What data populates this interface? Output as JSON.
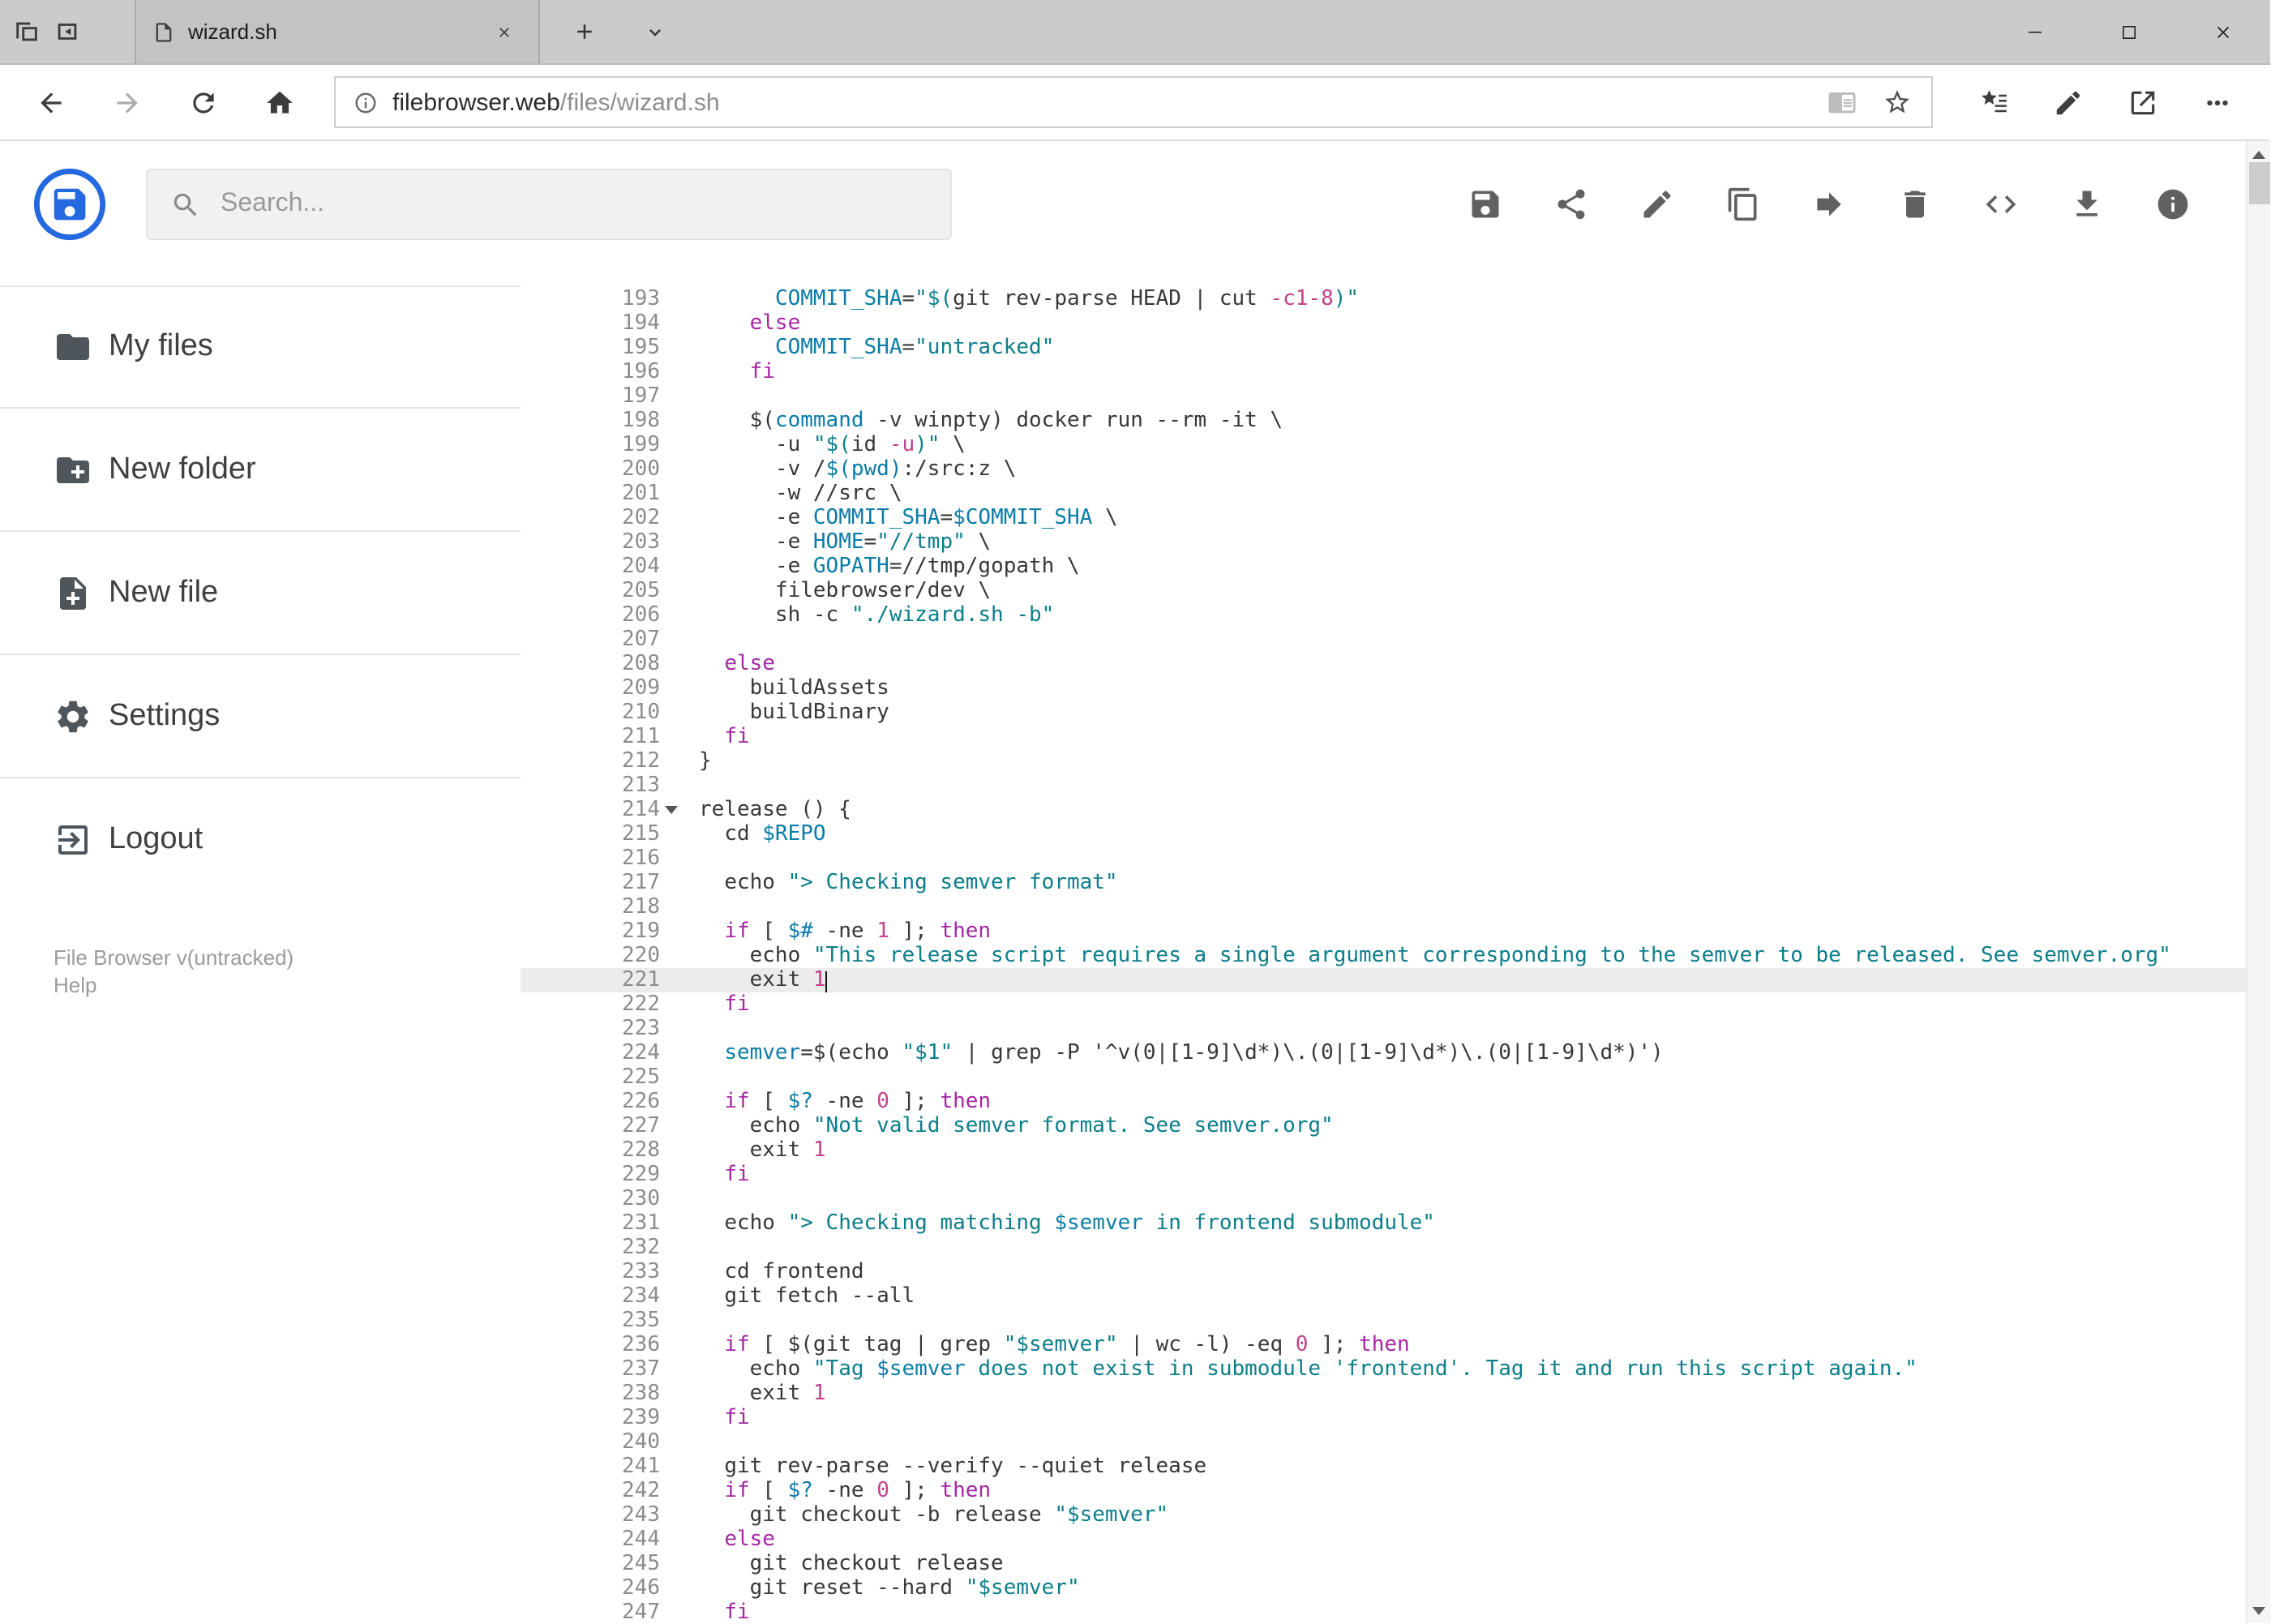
{
  "browser": {
    "tab": {
      "title": "wizard.sh"
    },
    "address": {
      "host": "filebrowser.web",
      "path": "/files/wizard.sh"
    }
  },
  "app": {
    "search_placeholder": "Search...",
    "toolbar_icons": [
      "save",
      "share",
      "rename",
      "copy",
      "move",
      "delete",
      "code",
      "download",
      "info"
    ],
    "sidebar": {
      "items": [
        {
          "id": "my-files",
          "icon": "folder",
          "label": "My files"
        },
        {
          "id": "new-folder",
          "icon": "create-folder",
          "label": "New folder"
        },
        {
          "id": "new-file",
          "icon": "create-file",
          "label": "New file"
        },
        {
          "id": "settings",
          "icon": "settings",
          "label": "Settings"
        },
        {
          "id": "logout",
          "icon": "logout",
          "label": "Logout"
        }
      ],
      "footer": {
        "version": "File Browser v(untracked)",
        "help": "Help"
      }
    }
  },
  "editor": {
    "active_line": 221,
    "cursor_line": 221,
    "fold_marker_line": 214,
    "lines": [
      {
        "n": 193,
        "i": 6,
        "t": [
          [
            "v",
            "COMMIT_SHA"
          ],
          [
            "p",
            "="
          ],
          [
            "s",
            "\"$("
          ],
          [
            "p",
            "git rev-parse HEAD | cut "
          ],
          [
            "n",
            "-c1-8"
          ],
          [
            "s",
            ")\""
          ]
        ]
      },
      {
        "n": 194,
        "i": 4,
        "t": [
          [
            "k",
            "else"
          ]
        ]
      },
      {
        "n": 195,
        "i": 6,
        "t": [
          [
            "v",
            "COMMIT_SHA"
          ],
          [
            "p",
            "="
          ],
          [
            "s",
            "\"untracked\""
          ]
        ]
      },
      {
        "n": 196,
        "i": 4,
        "t": [
          [
            "k",
            "fi"
          ]
        ]
      },
      {
        "n": 197,
        "i": 0,
        "t": []
      },
      {
        "n": 198,
        "i": 4,
        "t": [
          [
            "p",
            "$("
          ],
          [
            "v",
            "command"
          ],
          [
            "p",
            " -v winpty) docker run --rm -it \\"
          ]
        ]
      },
      {
        "n": 199,
        "i": 6,
        "t": [
          [
            "p",
            "-u "
          ],
          [
            "s",
            "\"$("
          ],
          [
            "p",
            "id "
          ],
          [
            "n",
            "-u"
          ],
          [
            "s",
            ")\""
          ],
          [
            "p",
            " \\"
          ]
        ]
      },
      {
        "n": 200,
        "i": 6,
        "t": [
          [
            "p",
            "-v /"
          ],
          [
            "v",
            "$(pwd)"
          ],
          [
            "p",
            ":/src:z \\"
          ]
        ]
      },
      {
        "n": 201,
        "i": 6,
        "t": [
          [
            "p",
            "-w //src \\"
          ]
        ]
      },
      {
        "n": 202,
        "i": 6,
        "t": [
          [
            "p",
            "-e "
          ],
          [
            "v",
            "COMMIT_SHA"
          ],
          [
            "p",
            "="
          ],
          [
            "v",
            "$COMMIT_SHA"
          ],
          [
            "p",
            " \\"
          ]
        ]
      },
      {
        "n": 203,
        "i": 6,
        "t": [
          [
            "p",
            "-e "
          ],
          [
            "v",
            "HOME"
          ],
          [
            "p",
            "="
          ],
          [
            "s",
            "\"//tmp\""
          ],
          [
            "p",
            " \\"
          ]
        ]
      },
      {
        "n": 204,
        "i": 6,
        "t": [
          [
            "p",
            "-e "
          ],
          [
            "v",
            "GOPATH"
          ],
          [
            "p",
            "=//tmp/gopath \\"
          ]
        ]
      },
      {
        "n": 205,
        "i": 6,
        "t": [
          [
            "p",
            "filebrowser/dev \\"
          ]
        ]
      },
      {
        "n": 206,
        "i": 6,
        "t": [
          [
            "p",
            "sh -c "
          ],
          [
            "s",
            "\"./wizard.sh -b\""
          ]
        ]
      },
      {
        "n": 207,
        "i": 0,
        "t": []
      },
      {
        "n": 208,
        "i": 2,
        "t": [
          [
            "k",
            "else"
          ]
        ]
      },
      {
        "n": 209,
        "i": 4,
        "t": [
          [
            "p",
            "buildAssets"
          ]
        ]
      },
      {
        "n": 210,
        "i": 4,
        "t": [
          [
            "p",
            "buildBinary"
          ]
        ]
      },
      {
        "n": 211,
        "i": 2,
        "t": [
          [
            "k",
            "fi"
          ]
        ]
      },
      {
        "n": 212,
        "i": 0,
        "t": [
          [
            "p",
            "}"
          ]
        ]
      },
      {
        "n": 213,
        "i": 0,
        "t": []
      },
      {
        "n": 214,
        "i": 0,
        "t": [
          [
            "p",
            "release () {"
          ]
        ]
      },
      {
        "n": 215,
        "i": 2,
        "t": [
          [
            "p",
            "cd "
          ],
          [
            "v",
            "$REPO"
          ]
        ]
      },
      {
        "n": 216,
        "i": 0,
        "t": []
      },
      {
        "n": 217,
        "i": 2,
        "t": [
          [
            "p",
            "echo "
          ],
          [
            "s",
            "\"> Checking semver format\""
          ]
        ]
      },
      {
        "n": 218,
        "i": 0,
        "t": []
      },
      {
        "n": 219,
        "i": 2,
        "t": [
          [
            "k",
            "if"
          ],
          [
            "p",
            " [ "
          ],
          [
            "v",
            "$#"
          ],
          [
            "p",
            " -ne "
          ],
          [
            "n",
            "1"
          ],
          [
            "p",
            " ]; "
          ],
          [
            "k",
            "then"
          ]
        ]
      },
      {
        "n": 220,
        "i": 4,
        "t": [
          [
            "p",
            "echo "
          ],
          [
            "s",
            "\"This release script requires a single argument corresponding to the semver to be released. See semver.org\""
          ]
        ]
      },
      {
        "n": 221,
        "i": 4,
        "t": [
          [
            "p",
            "exit "
          ],
          [
            "n",
            "1"
          ]
        ]
      },
      {
        "n": 222,
        "i": 2,
        "t": [
          [
            "k",
            "fi"
          ]
        ]
      },
      {
        "n": 223,
        "i": 0,
        "t": []
      },
      {
        "n": 224,
        "i": 2,
        "t": [
          [
            "v",
            "semver"
          ],
          [
            "p",
            "=$(echo "
          ],
          [
            "s",
            "\"$1\""
          ],
          [
            "p",
            " | grep -P '^v(0|[1-9]\\d*)\\.(0|[1-9]\\d*)\\.(0|[1-9]\\d*)')"
          ]
        ]
      },
      {
        "n": 225,
        "i": 0,
        "t": []
      },
      {
        "n": 226,
        "i": 2,
        "t": [
          [
            "k",
            "if"
          ],
          [
            "p",
            " [ "
          ],
          [
            "v",
            "$?"
          ],
          [
            "p",
            " -ne "
          ],
          [
            "n",
            "0"
          ],
          [
            "p",
            " ]; "
          ],
          [
            "k",
            "then"
          ]
        ]
      },
      {
        "n": 227,
        "i": 4,
        "t": [
          [
            "p",
            "echo "
          ],
          [
            "s",
            "\"Not valid semver format. See semver.org\""
          ]
        ]
      },
      {
        "n": 228,
        "i": 4,
        "t": [
          [
            "p",
            "exit "
          ],
          [
            "n",
            "1"
          ]
        ]
      },
      {
        "n": 229,
        "i": 2,
        "t": [
          [
            "k",
            "fi"
          ]
        ]
      },
      {
        "n": 230,
        "i": 0,
        "t": []
      },
      {
        "n": 231,
        "i": 2,
        "t": [
          [
            "p",
            "echo "
          ],
          [
            "s",
            "\"> Checking matching "
          ],
          [
            "v",
            "$semver"
          ],
          [
            "s",
            " in frontend submodule\""
          ]
        ]
      },
      {
        "n": 232,
        "i": 0,
        "t": []
      },
      {
        "n": 233,
        "i": 2,
        "t": [
          [
            "p",
            "cd frontend"
          ]
        ]
      },
      {
        "n": 234,
        "i": 2,
        "t": [
          [
            "p",
            "git fetch --all"
          ]
        ]
      },
      {
        "n": 235,
        "i": 0,
        "t": []
      },
      {
        "n": 236,
        "i": 2,
        "t": [
          [
            "k",
            "if"
          ],
          [
            "p",
            " [ $(git tag | grep "
          ],
          [
            "s",
            "\"$semver\""
          ],
          [
            "p",
            " | wc -l) -eq "
          ],
          [
            "n",
            "0"
          ],
          [
            "p",
            " ]; "
          ],
          [
            "k",
            "then"
          ]
        ]
      },
      {
        "n": 237,
        "i": 4,
        "t": [
          [
            "p",
            "echo "
          ],
          [
            "s",
            "\"Tag "
          ],
          [
            "v",
            "$semver"
          ],
          [
            "s",
            " does not exist in submodule 'frontend'. Tag it and run this script again.\""
          ]
        ]
      },
      {
        "n": 238,
        "i": 4,
        "t": [
          [
            "p",
            "exit "
          ],
          [
            "n",
            "1"
          ]
        ]
      },
      {
        "n": 239,
        "i": 2,
        "t": [
          [
            "k",
            "fi"
          ]
        ]
      },
      {
        "n": 240,
        "i": 0,
        "t": []
      },
      {
        "n": 241,
        "i": 2,
        "t": [
          [
            "p",
            "git rev-parse --verify --quiet release"
          ]
        ]
      },
      {
        "n": 242,
        "i": 2,
        "t": [
          [
            "k",
            "if"
          ],
          [
            "p",
            " [ "
          ],
          [
            "v",
            "$?"
          ],
          [
            "p",
            " -ne "
          ],
          [
            "n",
            "0"
          ],
          [
            "p",
            " ]; "
          ],
          [
            "k",
            "then"
          ]
        ]
      },
      {
        "n": 243,
        "i": 4,
        "t": [
          [
            "p",
            "git checkout -b release "
          ],
          [
            "s",
            "\"$semver\""
          ]
        ]
      },
      {
        "n": 244,
        "i": 2,
        "t": [
          [
            "k",
            "else"
          ]
        ]
      },
      {
        "n": 245,
        "i": 4,
        "t": [
          [
            "p",
            "git checkout release"
          ]
        ]
      },
      {
        "n": 246,
        "i": 4,
        "t": [
          [
            "p",
            "git reset --hard "
          ],
          [
            "s",
            "\"$semver\""
          ]
        ]
      },
      {
        "n": 247,
        "i": 2,
        "t": [
          [
            "k",
            "fi"
          ]
        ]
      }
    ]
  },
  "colors": {
    "keyword": "#a626a4",
    "string": "#0c7e8a",
    "variable": "#0b7ca8",
    "number": "#c2428b",
    "plain": "#383838",
    "accent": "#2469e0"
  }
}
